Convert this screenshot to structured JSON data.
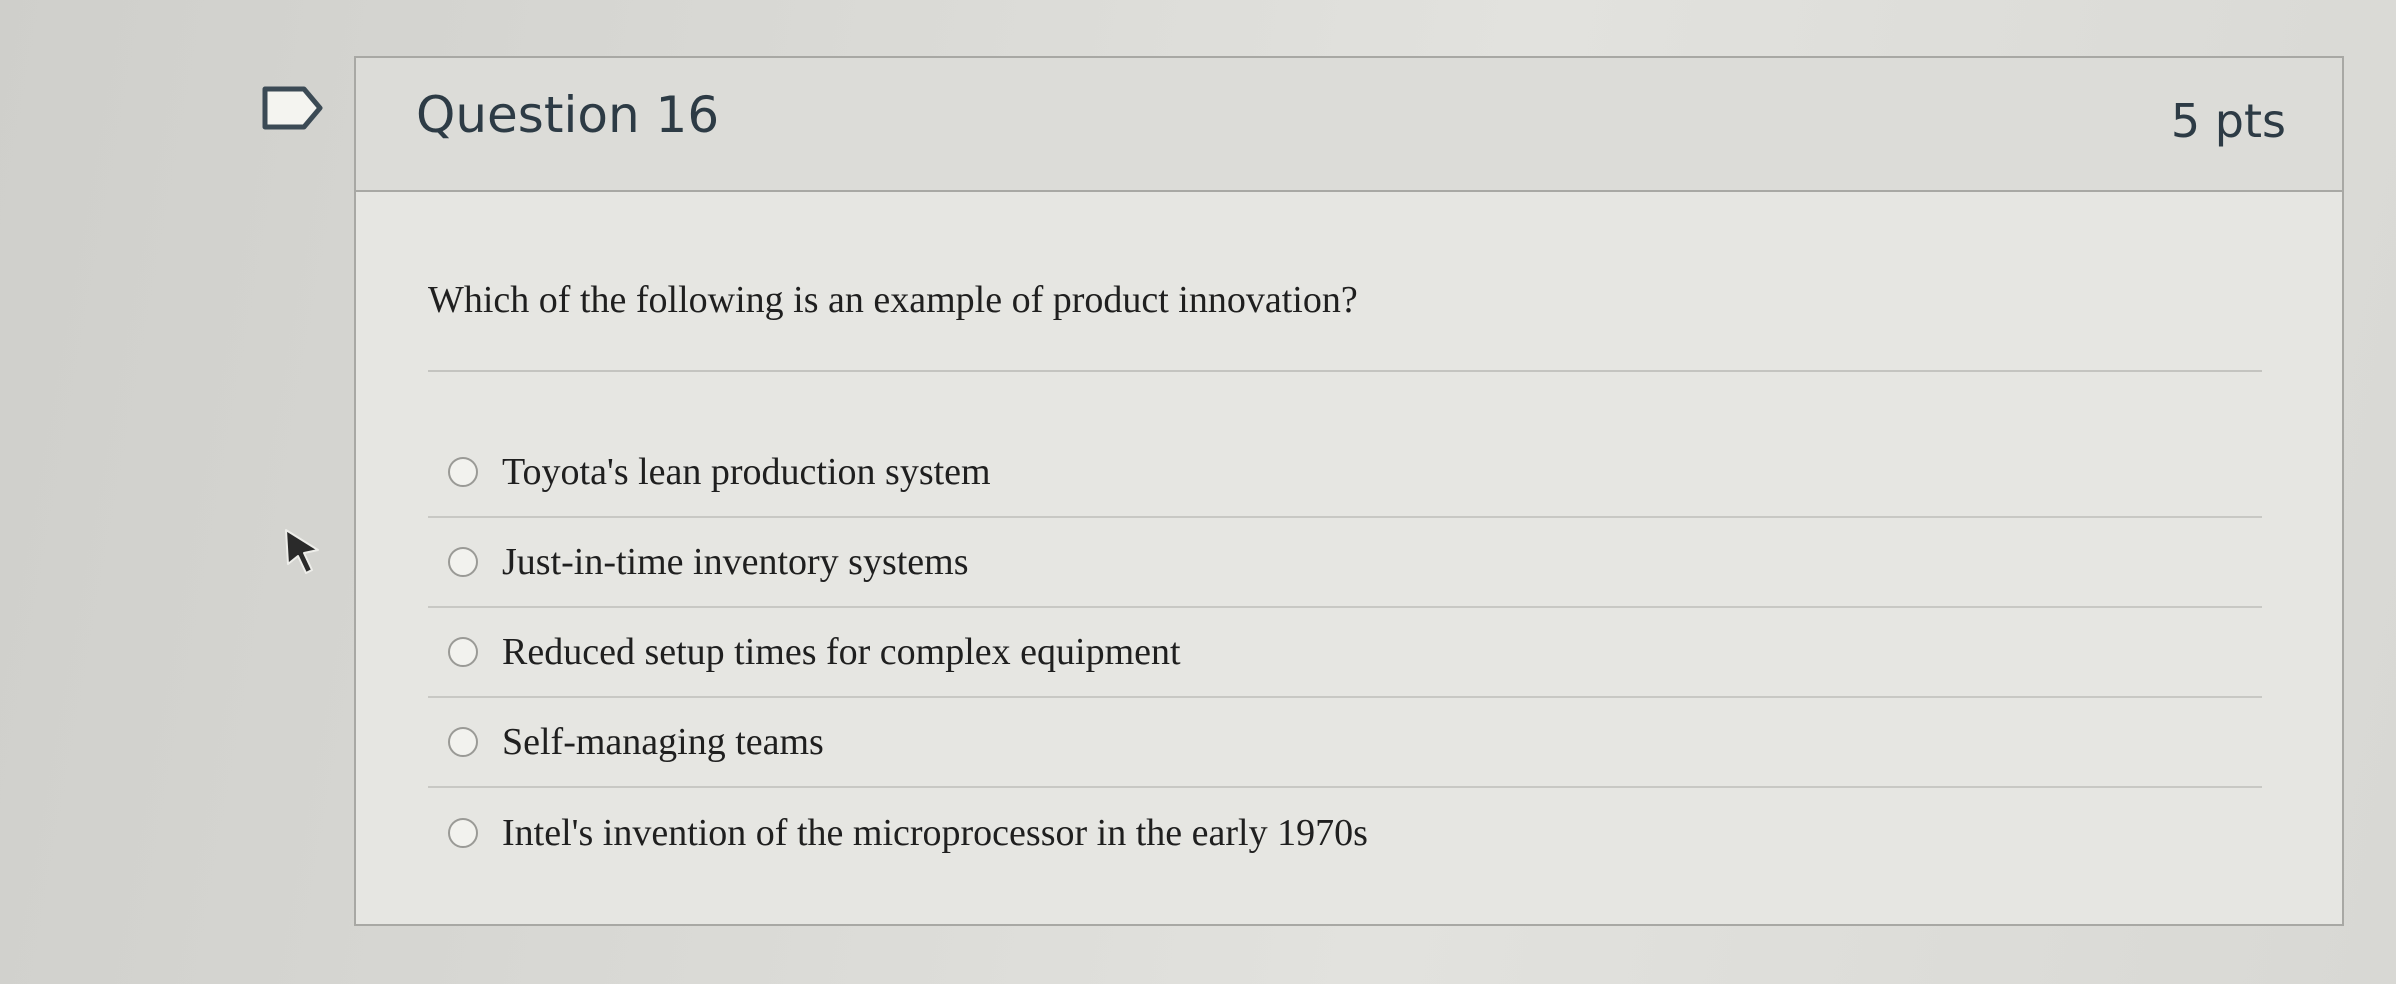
{
  "question": {
    "title": "Question 16",
    "points": "5 pts",
    "text": "Which of the following is an example of product innovation?",
    "answers": [
      {
        "label": "Toyota's lean production system"
      },
      {
        "label": "Just-in-time inventory systems"
      },
      {
        "label": "Reduced setup times for complex equipment"
      },
      {
        "label": "Self-managing teams"
      },
      {
        "label": "Intel's invention of the microprocessor in the early 1970s"
      }
    ]
  },
  "icons": {
    "flag": "flag-question-icon",
    "cursor": "mouse-pointer-icon"
  },
  "colors": {
    "title_text": "#2d3b45",
    "body_text": "#1f1f1f",
    "border": "#a8a8a4"
  }
}
